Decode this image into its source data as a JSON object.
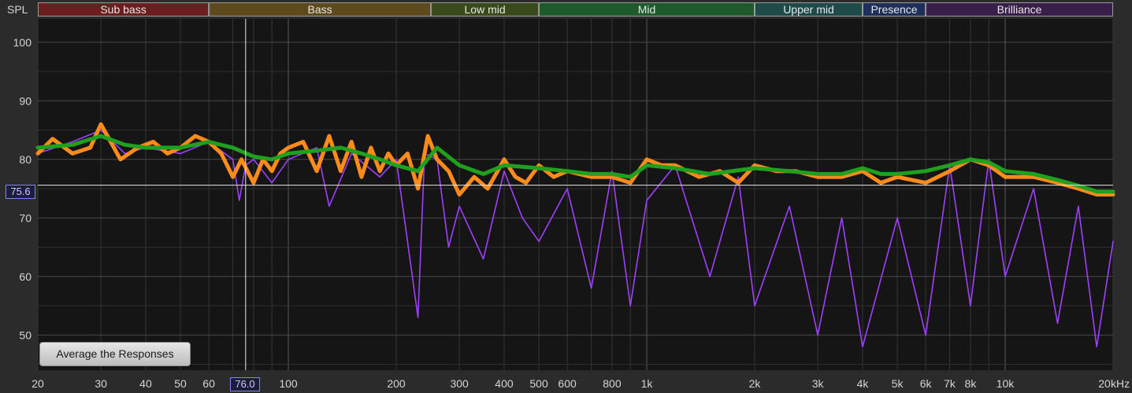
{
  "chart_data": {
    "type": "line",
    "ylabel": "SPL",
    "xunit": "kHz",
    "xscale": "log",
    "xlim": [
      20,
      20000
    ],
    "ylim": [
      44,
      104
    ],
    "grid": true,
    "y_ticks": [
      50,
      60,
      70,
      80,
      90,
      100
    ],
    "x_ticks": [
      {
        "v": 20,
        "label": "20"
      },
      {
        "v": 30,
        "label": "30"
      },
      {
        "v": 40,
        "label": "40"
      },
      {
        "v": 50,
        "label": "50"
      },
      {
        "v": 60,
        "label": "60"
      },
      {
        "v": 70,
        "label": "7"
      },
      {
        "v": 100,
        "label": "100"
      },
      {
        "v": 200,
        "label": "200"
      },
      {
        "v": 300,
        "label": "300"
      },
      {
        "v": 400,
        "label": "400"
      },
      {
        "v": 500,
        "label": "500"
      },
      {
        "v": 600,
        "label": "600"
      },
      {
        "v": 800,
        "label": "800"
      },
      {
        "v": 1000,
        "label": "1k"
      },
      {
        "v": 2000,
        "label": "2k"
      },
      {
        "v": 3000,
        "label": "3k"
      },
      {
        "v": 4000,
        "label": "4k"
      },
      {
        "v": 5000,
        "label": "5k"
      },
      {
        "v": 6000,
        "label": "6k"
      },
      {
        "v": 7000,
        "label": "7k"
      },
      {
        "v": 8000,
        "label": "8k"
      },
      {
        "v": 10000,
        "label": "10k"
      },
      {
        "v": 20000,
        "label": "20"
      }
    ],
    "bands": [
      {
        "label": "Sub bass",
        "from": 20,
        "to": 60,
        "color": "#6b1e1e"
      },
      {
        "label": "Bass",
        "from": 60,
        "to": 250,
        "color": "#5e4a1c"
      },
      {
        "label": "Low mid",
        "from": 250,
        "to": 500,
        "color": "#3a4a1a"
      },
      {
        "label": "Mid",
        "from": 500,
        "to": 2000,
        "color": "#1f5a2a"
      },
      {
        "label": "Upper mid",
        "from": 2000,
        "to": 4000,
        "color": "#1e4a4a"
      },
      {
        "label": "Presence",
        "from": 4000,
        "to": 6000,
        "color": "#1e2f5a"
      },
      {
        "label": "Brilliance",
        "from": 6000,
        "to": 20000,
        "color": "#3a1e4a"
      }
    ],
    "cursor": {
      "x": 76.0,
      "y": 75.6,
      "x_label": "76.0",
      "y_label": "75.6"
    },
    "series": [
      {
        "color": "#a040ff",
        "x": [
          20,
          25,
          30,
          35,
          40,
          50,
          60,
          70,
          73,
          76,
          80,
          90,
          100,
          120,
          130,
          150,
          180,
          200,
          230,
          240,
          260,
          280,
          300,
          350,
          400,
          450,
          500,
          600,
          700,
          800,
          900,
          1000,
          1200,
          1500,
          1800,
          2000,
          2500,
          3000,
          3500,
          4000,
          5000,
          6000,
          7000,
          8000,
          9000,
          10000,
          12000,
          14000,
          16000,
          18000,
          20000
        ],
        "y": [
          81,
          83,
          85,
          81,
          82,
          81,
          83,
          80,
          73,
          79,
          80,
          76,
          80,
          82,
          72,
          81,
          77,
          80,
          53,
          81,
          80,
          65,
          72,
          63,
          78,
          70,
          66,
          75,
          58,
          78,
          55,
          73,
          79,
          60,
          77,
          55,
          72,
          50,
          70,
          48,
          70,
          50,
          79,
          55,
          80,
          60,
          75,
          52,
          72,
          48,
          66
        ]
      },
      {
        "color": "#ff8c1a",
        "x": [
          20,
          22,
          25,
          28,
          30,
          34,
          38,
          42,
          46,
          50,
          55,
          60,
          65,
          70,
          74,
          80,
          85,
          90,
          95,
          100,
          110,
          120,
          130,
          140,
          150,
          160,
          170,
          180,
          190,
          200,
          215,
          230,
          245,
          260,
          280,
          300,
          330,
          360,
          400,
          430,
          460,
          500,
          550,
          600,
          700,
          800,
          900,
          1000,
          1100,
          1200,
          1400,
          1600,
          1800,
          2000,
          2300,
          2600,
          3000,
          3500,
          4000,
          4500,
          5000,
          6000,
          7000,
          8000,
          9000,
          10000,
          12000,
          14000,
          16000,
          18000,
          20000
        ],
        "y": [
          81,
          83.5,
          81,
          82,
          86,
          80,
          82,
          83,
          81,
          82,
          84,
          83,
          81,
          77,
          80,
          76,
          80,
          78,
          81,
          82,
          83,
          78,
          84,
          78,
          83,
          77,
          82,
          78,
          81,
          79,
          81,
          75,
          84,
          80,
          78,
          74,
          77,
          75,
          80,
          77,
          76,
          79,
          77,
          78,
          77,
          77,
          76,
          80,
          79,
          79,
          77,
          78,
          76,
          79,
          78,
          78,
          77,
          77,
          78,
          76,
          77,
          76,
          78,
          80,
          79,
          77,
          77,
          76,
          75,
          74,
          74
        ]
      },
      {
        "color": "#1fa01f",
        "x": [
          20,
          25,
          30,
          35,
          40,
          50,
          60,
          70,
          80,
          90,
          100,
          120,
          140,
          160,
          180,
          200,
          230,
          260,
          300,
          350,
          400,
          500,
          600,
          700,
          800,
          900,
          1000,
          1200,
          1500,
          2000,
          2500,
          3000,
          3500,
          4000,
          4500,
          5000,
          6000,
          7000,
          8000,
          9000,
          10000,
          12000,
          14000,
          16000,
          18000,
          20000
        ],
        "y": [
          82,
          82.5,
          84,
          82.5,
          82,
          82,
          83,
          82,
          80.5,
          80,
          81,
          81.5,
          82,
          81,
          80,
          79,
          78,
          82,
          79,
          77.5,
          79,
          78.5,
          78,
          77.5,
          77.5,
          77,
          79,
          78.5,
          77.5,
          78.5,
          78,
          77.5,
          77.5,
          78.5,
          77.5,
          77.5,
          78,
          79,
          80,
          79.5,
          78,
          77.5,
          76.5,
          75.5,
          74.5,
          74.5
        ]
      }
    ]
  },
  "ui": {
    "button_label": "Average the Responses"
  }
}
